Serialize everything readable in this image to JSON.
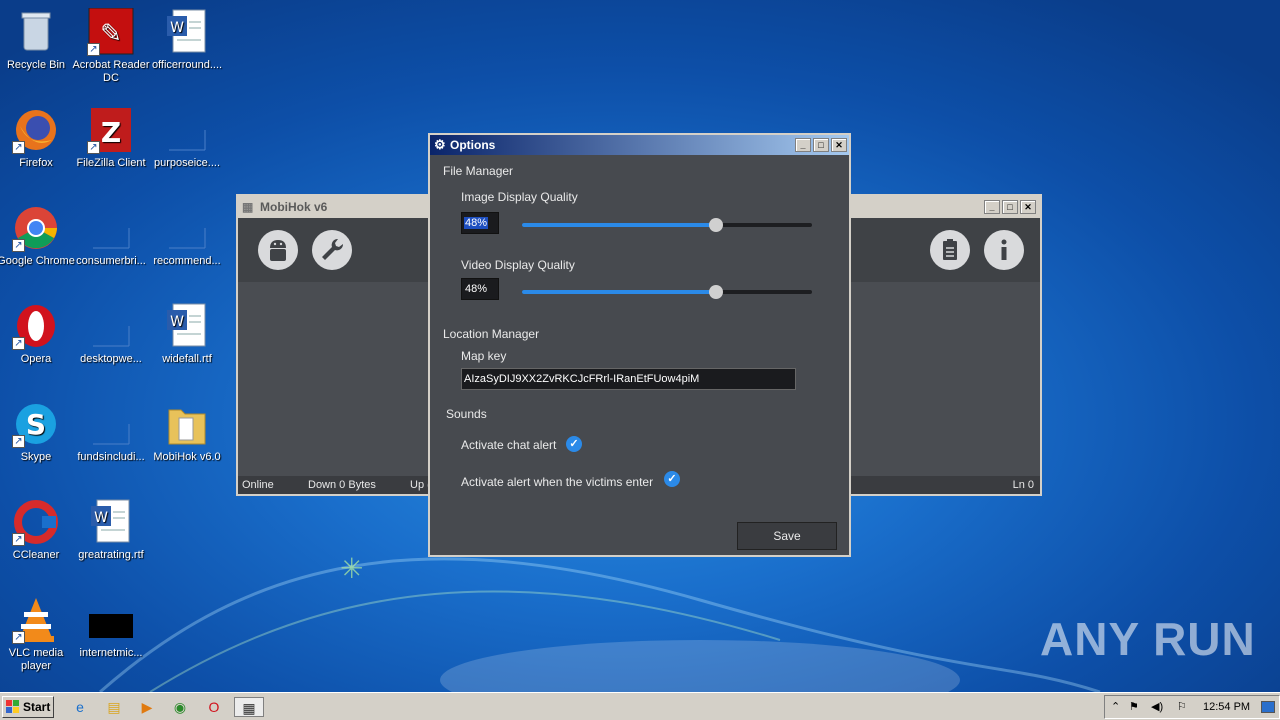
{
  "desktop": {
    "icons": [
      {
        "label": "Recycle Bin",
        "icon": "recycle-bin-icon"
      },
      {
        "label": "Acrobat Reader DC",
        "icon": "acrobat-icon"
      },
      {
        "label": "officerround....",
        "icon": "word-doc-icon"
      },
      {
        "label": "Firefox",
        "icon": "firefox-icon"
      },
      {
        "label": "FileZilla Client",
        "icon": "filezilla-icon"
      },
      {
        "label": "purposeice....",
        "icon": "blank-file-icon"
      },
      {
        "label": "Google Chrome",
        "icon": "chrome-icon"
      },
      {
        "label": "consumerbri...",
        "icon": "blank-file-icon"
      },
      {
        "label": "recommend...",
        "icon": "blank-file-icon"
      },
      {
        "label": "Opera",
        "icon": "opera-icon"
      },
      {
        "label": "desktopwe...",
        "icon": "blank-file-icon"
      },
      {
        "label": "widefall.rtf",
        "icon": "word-doc-icon"
      },
      {
        "label": "Skype",
        "icon": "skype-icon"
      },
      {
        "label": "fundsincludi...",
        "icon": "blank-file-icon"
      },
      {
        "label": "MobiHok v6.0",
        "icon": "folder-icon"
      },
      {
        "label": "CCleaner",
        "icon": "ccleaner-icon"
      },
      {
        "label": "greatrating.rtf",
        "icon": "word-doc-icon"
      },
      {
        "label": "VLC media player",
        "icon": "vlc-icon"
      },
      {
        "label": "internetmic...",
        "icon": "black-file-icon"
      }
    ],
    "watermark": "ANY RUN"
  },
  "mobihok": {
    "title": "MobiHok v6",
    "status": {
      "online": "Online",
      "down": "Down 0 Bytes",
      "up": "Up (",
      "ln": "Ln 0"
    }
  },
  "options": {
    "title": "Options",
    "file_manager": "File Manager",
    "image_quality_label": "Image Display Quality",
    "image_quality_value": "48%",
    "image_quality_fraction": 0.67,
    "video_quality_label": "Video Display Quality",
    "video_quality_value": "48%",
    "video_quality_fraction": 0.67,
    "location_manager": "Location Manager",
    "map_key_label": "Map key",
    "map_key_value": "AIzaSyDIJ9XX2ZvRKCJcFRrl-IRanEtFUow4piM",
    "sounds": "Sounds",
    "chat_alert_label": "Activate chat alert",
    "victims_alert_label": "Activate alert when the victims enter",
    "save_label": "Save",
    "accent": "#2b8ae8"
  },
  "taskbar": {
    "start_label": "Start",
    "time": "12:54 PM"
  }
}
